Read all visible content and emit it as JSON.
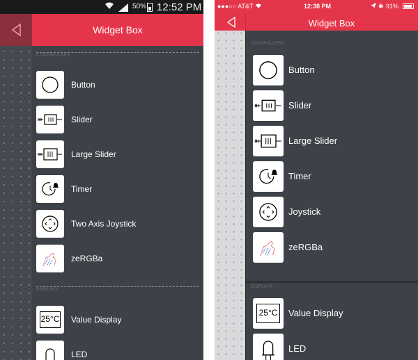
{
  "colors": {
    "accent": "#e5354a",
    "accent_dark": "#8b2f3c",
    "drawer_bg": "#3d4248",
    "android_statusbar": "#1a1a1a"
  },
  "android": {
    "status_bar": {
      "wifi_icon": "wifi-icon",
      "signal_icon": "signal-icon",
      "battery_percent": "50%",
      "time": "12:52 PM"
    },
    "header": {
      "back_icon": "back-arrow-icon",
      "title": "Widget Box"
    },
    "sections": [
      {
        "label": "CONTROLLERS",
        "items": [
          {
            "label": "Button",
            "icon": "button-icon"
          },
          {
            "label": "Slider",
            "icon": "slider-icon"
          },
          {
            "label": "Large Slider",
            "icon": "large-slider-icon"
          },
          {
            "label": "Timer",
            "icon": "timer-icon"
          },
          {
            "label": "Two Axis Joystick",
            "icon": "joystick-icon"
          },
          {
            "label": "zeRGBa",
            "icon": "zergba-icon"
          }
        ]
      },
      {
        "label": "DISPLAYS",
        "items": [
          {
            "label": "Value Display",
            "icon": "value-display-icon",
            "icon_text": "25°C"
          },
          {
            "label": "LED",
            "icon": "led-icon"
          }
        ]
      }
    ]
  },
  "ios": {
    "status_bar": {
      "carrier": "●●●○○ AT&T",
      "wifi_icon": "wifi-icon",
      "time": "12:38 PM",
      "location_icon": "location-icon",
      "bluetooth": "✱",
      "battery_percent": "91%"
    },
    "header": {
      "back_icon": "back-arrow-icon",
      "title": "Widget Box"
    },
    "sections": [
      {
        "label": "CONTROLLERS",
        "items": [
          {
            "label": "Button",
            "icon": "button-icon"
          },
          {
            "label": "Slider",
            "icon": "slider-icon"
          },
          {
            "label": "Large Slider",
            "icon": "large-slider-icon"
          },
          {
            "label": "Timer",
            "icon": "timer-icon"
          },
          {
            "label": "Joystick",
            "icon": "joystick-icon"
          },
          {
            "label": "zeRGBa",
            "icon": "zergba-icon"
          }
        ]
      },
      {
        "label": "DISPLAYS",
        "items": [
          {
            "label": "Value Display",
            "icon": "value-display-icon",
            "icon_text": "25°C"
          },
          {
            "label": "LED",
            "icon": "led-icon"
          }
        ]
      }
    ]
  }
}
